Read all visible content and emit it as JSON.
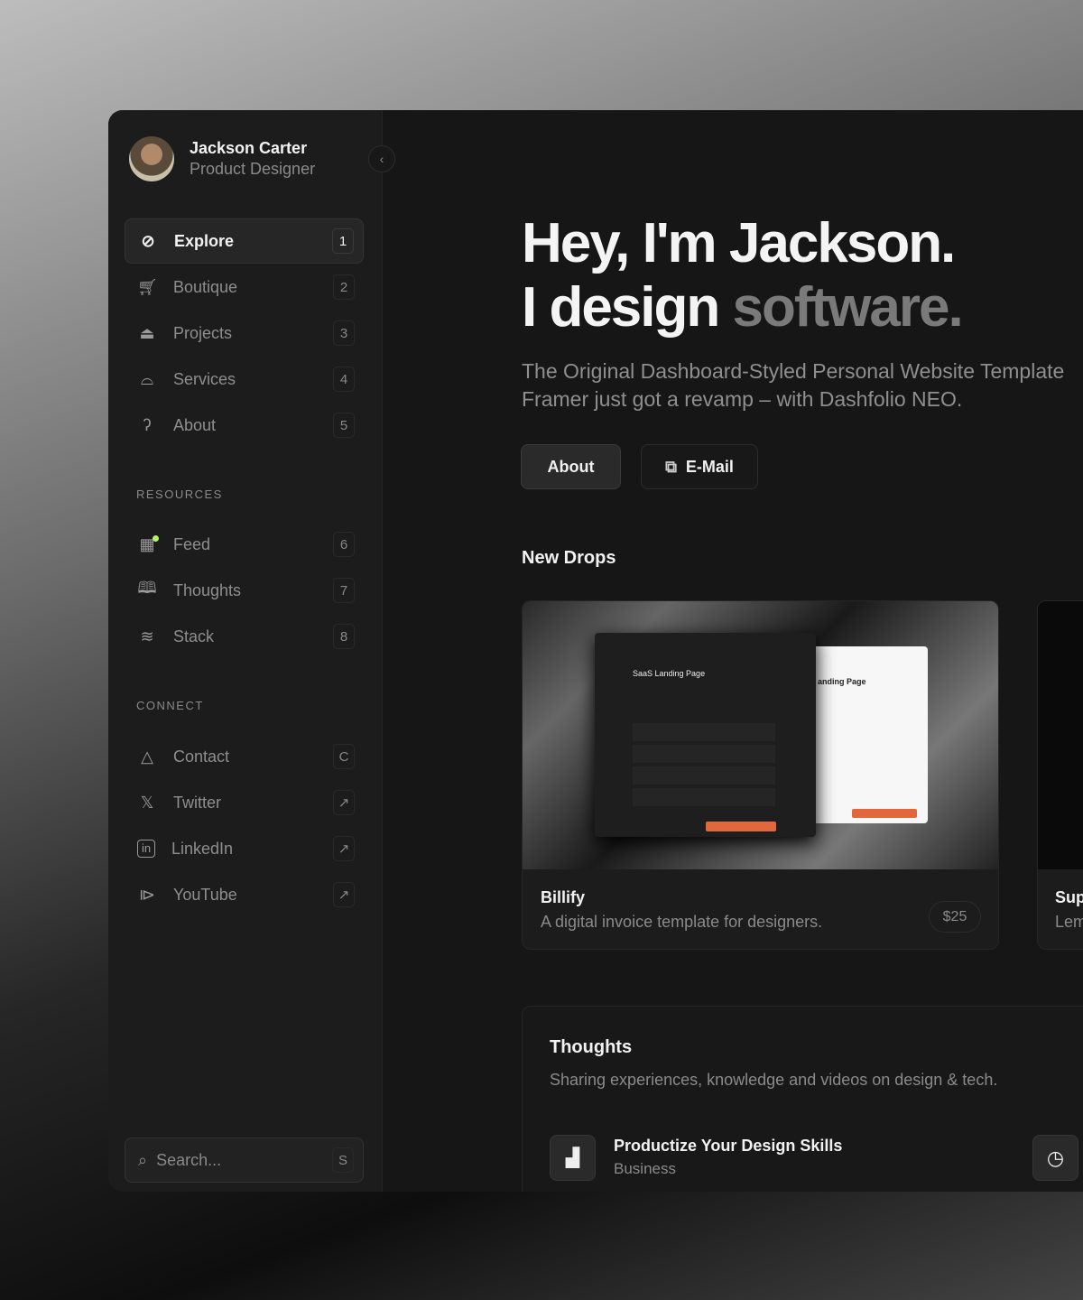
{
  "profile": {
    "name": "Jackson Carter",
    "role": "Product Designer"
  },
  "nav": [
    {
      "label": "Explore",
      "key": "1",
      "icon": "compass-icon"
    },
    {
      "label": "Boutique",
      "key": "2",
      "icon": "cart-icon"
    },
    {
      "label": "Projects",
      "key": "3",
      "icon": "pen-nib-icon"
    },
    {
      "label": "Services",
      "key": "4",
      "icon": "bell-cloche-icon"
    },
    {
      "label": "About",
      "key": "5",
      "icon": "head-icon"
    }
  ],
  "resources": {
    "title": "RESOURCES",
    "items": [
      {
        "label": "Feed",
        "key": "6",
        "icon": "feed-icon"
      },
      {
        "label": "Thoughts",
        "key": "7",
        "icon": "book-icon"
      },
      {
        "label": "Stack",
        "key": "8",
        "icon": "layers-icon"
      }
    ]
  },
  "connect": {
    "title": "CONNECT",
    "items": [
      {
        "label": "Contact",
        "key": "C",
        "icon": "contact-icon"
      },
      {
        "label": "Twitter",
        "key": "↗",
        "icon": "x-icon"
      },
      {
        "label": "LinkedIn",
        "key": "↗",
        "icon": "linkedin-icon"
      },
      {
        "label": "YouTube",
        "key": "↗",
        "icon": "youtube-icon"
      }
    ]
  },
  "search": {
    "placeholder": "Search...",
    "key": "S"
  },
  "hero": {
    "line1": "Hey, I'm Jackson.",
    "line2a": "I design ",
    "line2b": "software.",
    "sub1": "The Original Dashboard-Styled Personal Website Template",
    "sub2": "Framer just got a revamp – with Dashfolio NEO.",
    "about": "About",
    "email": "E-Mail"
  },
  "drops": {
    "title": "New Drops",
    "cards": [
      {
        "title": "Billify",
        "desc": "A digital invoice template for designers.",
        "price": "$25",
        "mock_title": "SaaS Landing Page",
        "mock_title2": "anding Page"
      },
      {
        "title": "Sup",
        "desc": "Lem"
      }
    ]
  },
  "thoughts": {
    "title": "Thoughts",
    "sub": "Sharing experiences, knowledge and videos on design & tech.",
    "items": [
      {
        "title": "Productize Your Design Skills",
        "category": "Business"
      }
    ]
  },
  "colors": {
    "accent": "#e0683c",
    "feed_dot": "#b6f36a"
  }
}
